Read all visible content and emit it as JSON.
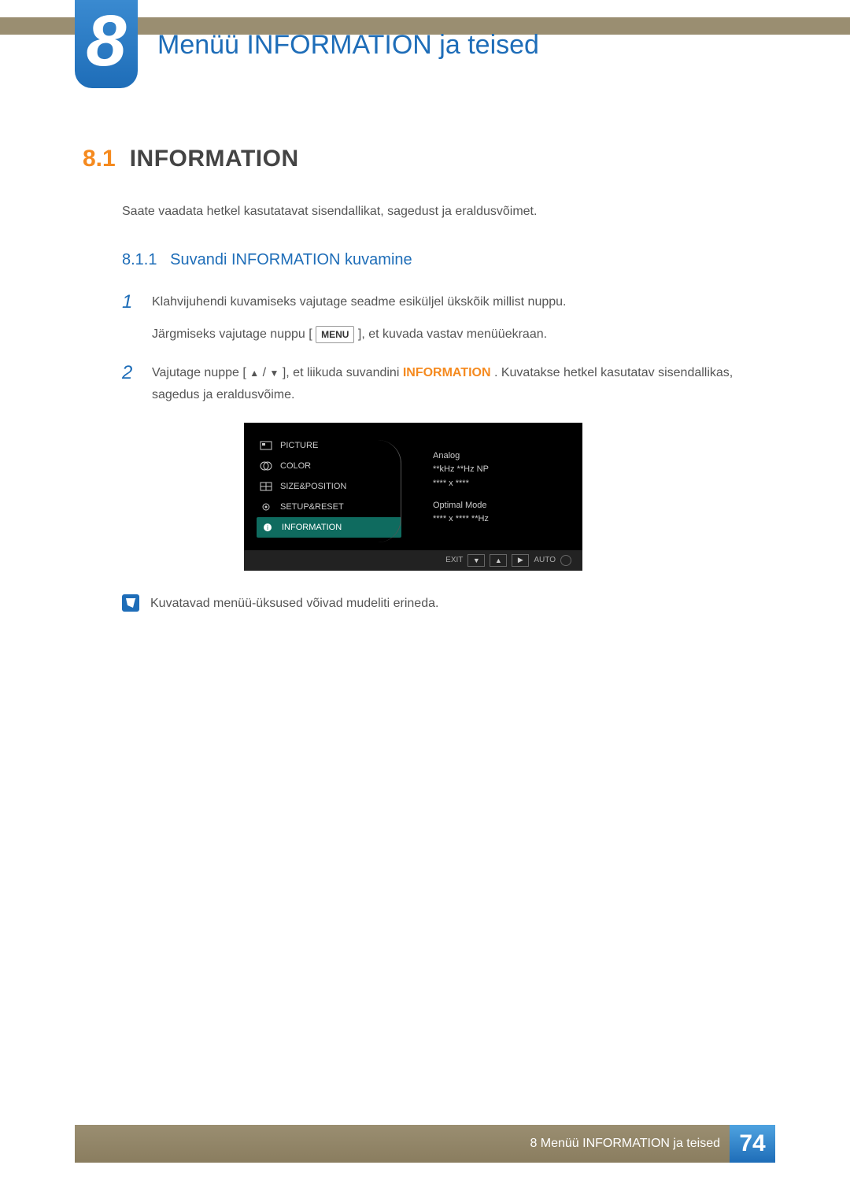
{
  "chapter": {
    "number": "8",
    "title": "Menüü INFORMATION ja teised"
  },
  "h1": {
    "number": "8.1",
    "text": "INFORMATION"
  },
  "intro": "Saate vaadata hetkel kasutatavat sisendallikat, sagedust ja eraldusvõimet.",
  "h2": {
    "number": "8.1.1",
    "text": "Suvandi INFORMATION kuvamine"
  },
  "steps": [
    {
      "num": "1",
      "line1": "Klahvijuhendi kuvamiseks vajutage seadme esiküljel ükskõik millist nuppu.",
      "line2a": "Järgmiseks vajutage nuppu [",
      "menu_chip": "MENU",
      "line2b": "], et kuvada vastav menüüekraan."
    },
    {
      "num": "2",
      "pre": "Vajutage nuppe [",
      "mid": "], et liikuda suvandini ",
      "keyword": "INFORMATION",
      "post": ". Kuvatakse hetkel kasutatav sisendallikas, sagedus ja eraldusvõime."
    }
  ],
  "osd": {
    "items": [
      "PICTURE",
      "COLOR",
      "SIZE&POSITION",
      "SETUP&RESET",
      "INFORMATION"
    ],
    "selected_index": 4,
    "info": {
      "l1": "Analog",
      "l2": "**kHz **Hz NP",
      "l3": "**** x ****",
      "l4": "Optimal Mode",
      "l5": "**** x ****   **Hz"
    },
    "bar": {
      "exit": "EXIT",
      "auto": "AUTO"
    }
  },
  "note": "Kuvatavad menüü-üksused võivad mudeliti erineda.",
  "footer": {
    "text": "8 Menüü INFORMATION ja teised",
    "page": "74"
  }
}
